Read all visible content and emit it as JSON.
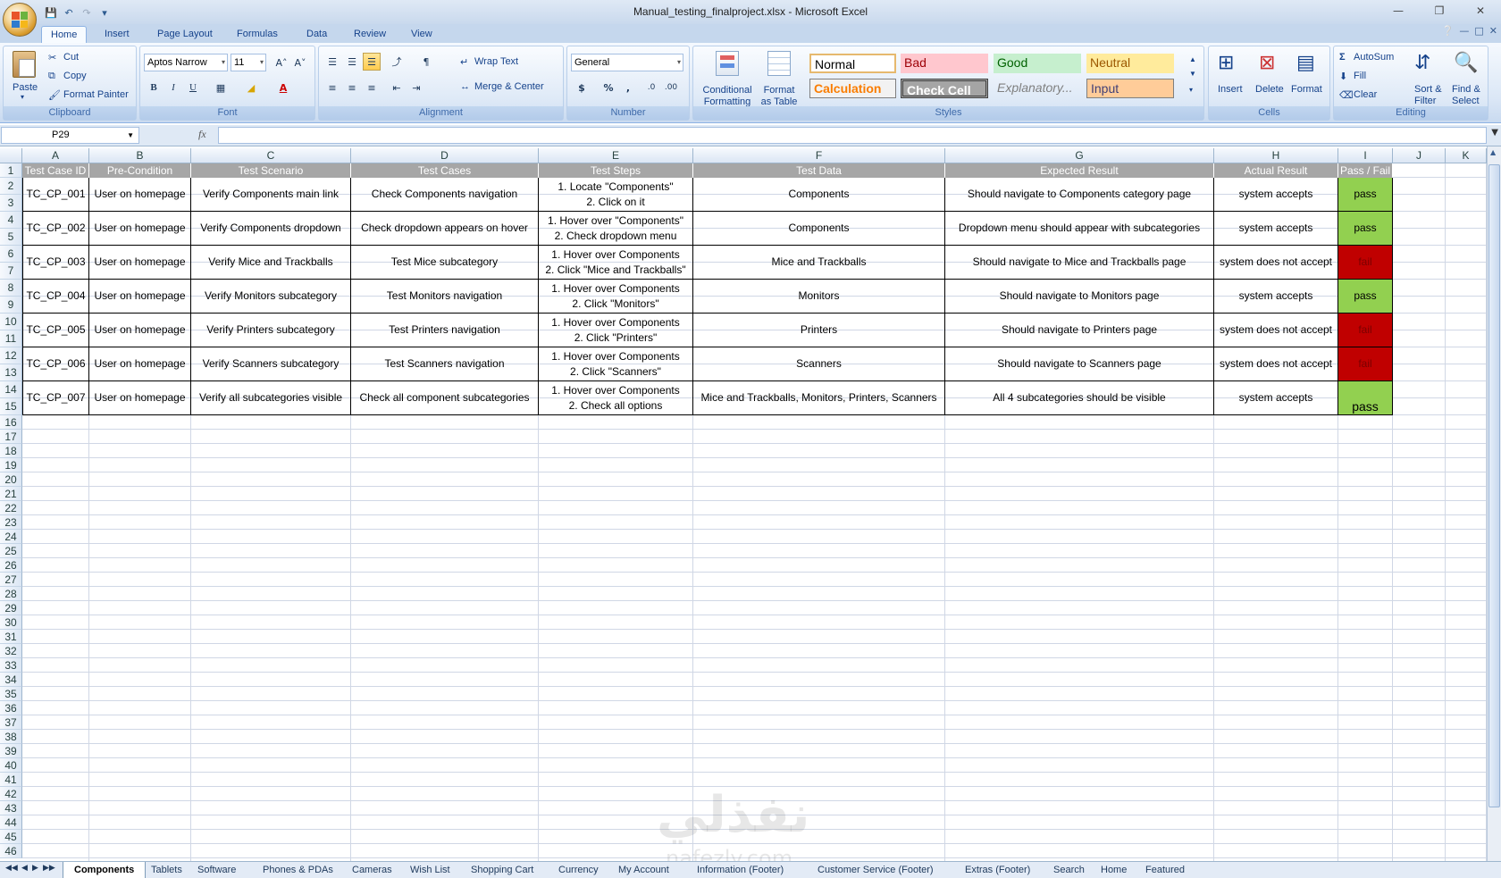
{
  "window": {
    "title": "Manual_testing_finalproject.xlsx - Microsoft Excel",
    "controls": [
      "—",
      "❐",
      "✕"
    ]
  },
  "tabs": [
    "Home",
    "Insert",
    "Page Layout",
    "Formulas",
    "Data",
    "Review",
    "View"
  ],
  "ribbon": {
    "clipboard": {
      "paste": "Paste",
      "cut": "Cut",
      "copy": "Copy",
      "format_painter": "Format Painter",
      "label": "Clipboard"
    },
    "font": {
      "name": "Aptos Narrow",
      "size": "11",
      "label": "Font",
      "bold": "B",
      "italic": "I",
      "underline": "U",
      "grow": "A˄",
      "shrink": "A˅",
      "font_color_letter": "A"
    },
    "alignment": {
      "wrap": "Wrap Text",
      "merge": "Merge & Center",
      "label": "Alignment"
    },
    "number": {
      "format": "General",
      "label": "Number",
      "currency": "$",
      "percent": "%",
      "comma": ",",
      "inc_decimal": ".0",
      "dec_decimal": ".00"
    },
    "styles": {
      "conditional": [
        "Conditional",
        "Formatting"
      ],
      "format_table": [
        "Format",
        "as Table"
      ],
      "normal": "Normal",
      "bad": "Bad",
      "good": "Good",
      "neutral": "Neutral",
      "calculation": "Calculation",
      "check_cell": "Check Cell",
      "explanatory": "Explanatory...",
      "input": "Input",
      "label": "Styles"
    },
    "cells": {
      "insert": "Insert",
      "delete": "Delete",
      "format": "Format",
      "label": "Cells"
    },
    "editing": {
      "autosum": "AutoSum",
      "fill": "Fill",
      "clear": "Clear",
      "sort": [
        "Sort &",
        "Filter"
      ],
      "find": [
        "Find &",
        "Select"
      ],
      "label": "Editing"
    }
  },
  "formula_bar": {
    "name_box": "P29",
    "fx": "fx",
    "value": ""
  },
  "columns": [
    "A",
    "B",
    "C",
    "D",
    "E",
    "F",
    "G",
    "H",
    "I",
    "J",
    "K"
  ],
  "header_row": [
    "Test Case ID",
    "Pre-Condition",
    "Test Scenario",
    "Test Cases",
    "Test Steps",
    "Test Data",
    "Expected Result",
    "Actual Result",
    "Pass / Fail"
  ],
  "rows": [
    {
      "id": "TC_CP_001",
      "pre": "User on homepage",
      "scenario": "Verify Components main link",
      "case": "Check Components navigation",
      "step1": "1. Locate \"Components\"",
      "step2": "2. Click on it",
      "data": "Components",
      "expected": "Should navigate to Components category page",
      "actual": "system accepts",
      "result": "pass"
    },
    {
      "id": "TC_CP_002",
      "pre": "User on homepage",
      "scenario": "Verify Components dropdown",
      "case": "Check dropdown appears on hover",
      "step1": "1. Hover over \"Components\"",
      "step2": "2. Check dropdown menu",
      "data": "Components",
      "expected": "Dropdown menu should appear with subcategories",
      "actual": "system accepts",
      "result": "pass"
    },
    {
      "id": "TC_CP_003",
      "pre": "User on homepage",
      "scenario": "Verify Mice and Trackballs",
      "case": "Test Mice subcategory",
      "step1": "1. Hover over Components",
      "step2": "2. Click \"Mice and Trackballs\"",
      "data": "Mice and Trackballs",
      "expected": "Should navigate to Mice and Trackballs page",
      "actual": "system does not accept",
      "result": "fail"
    },
    {
      "id": "TC_CP_004",
      "pre": "User on homepage",
      "scenario": "Verify Monitors subcategory",
      "case": "Test Monitors navigation",
      "step1": "1. Hover over Components",
      "step2": "2. Click \"Monitors\"",
      "data": "Monitors",
      "expected": "Should navigate to Monitors page",
      "actual": "system accepts",
      "result": "pass"
    },
    {
      "id": "TC_CP_005",
      "pre": "User on homepage",
      "scenario": "Verify Printers subcategory",
      "case": "Test Printers navigation",
      "step1": "1. Hover over Components",
      "step2": "2. Click \"Printers\"",
      "data": "Printers",
      "expected": "Should navigate to Printers page",
      "actual": "system does not accept",
      "result": "fail"
    },
    {
      "id": "TC_CP_006",
      "pre": "User on homepage",
      "scenario": "Verify Scanners subcategory",
      "case": "Test Scanners navigation",
      "step1": "1. Hover over Components",
      "step2": "2. Click \"Scanners\"",
      "data": "Scanners",
      "expected": "Should navigate to Scanners page",
      "actual": "system does not accept",
      "result": "fail"
    },
    {
      "id": "TC_CP_007",
      "pre": "User on homepage",
      "scenario": "Verify all subcategories visible",
      "case": "Check all component subcategories",
      "step1": "1. Hover over Components",
      "step2": "2. Check all options",
      "data": "Mice and Trackballs, Monitors, Printers, Scanners",
      "expected": "All 4 subcategories should be visible",
      "actual": "system accepts",
      "result": "pass"
    }
  ],
  "row_numbers": [
    "1",
    "2",
    "3",
    "4",
    "5",
    "6",
    "7",
    "8",
    "9",
    "10",
    "11",
    "12",
    "13",
    "14",
    "15",
    "16",
    "17",
    "18",
    "19",
    "20",
    "21",
    "22",
    "23",
    "24",
    "25",
    "26",
    "27",
    "28",
    "29",
    "30",
    "31",
    "32",
    "33",
    "34",
    "35",
    "36",
    "37",
    "38",
    "39",
    "40",
    "41",
    "42",
    "43",
    "44",
    "45",
    "46"
  ],
  "sheets": [
    "Components",
    "Tablets",
    "Software",
    "Phones & PDAs",
    "Cameras",
    "Wish List",
    "Shopping Cart",
    "Currency",
    "My Account",
    "Information (Footer)",
    "Customer Service (Footer)",
    "Extras (Footer)",
    "Search",
    "Home",
    "Featured"
  ],
  "watermark": {
    "arabic": "نفذلي",
    "latin": "nafezly.com"
  },
  "colors": {
    "pass": "#92d050",
    "fail": "#c00000",
    "header": "#a6a6a6"
  }
}
